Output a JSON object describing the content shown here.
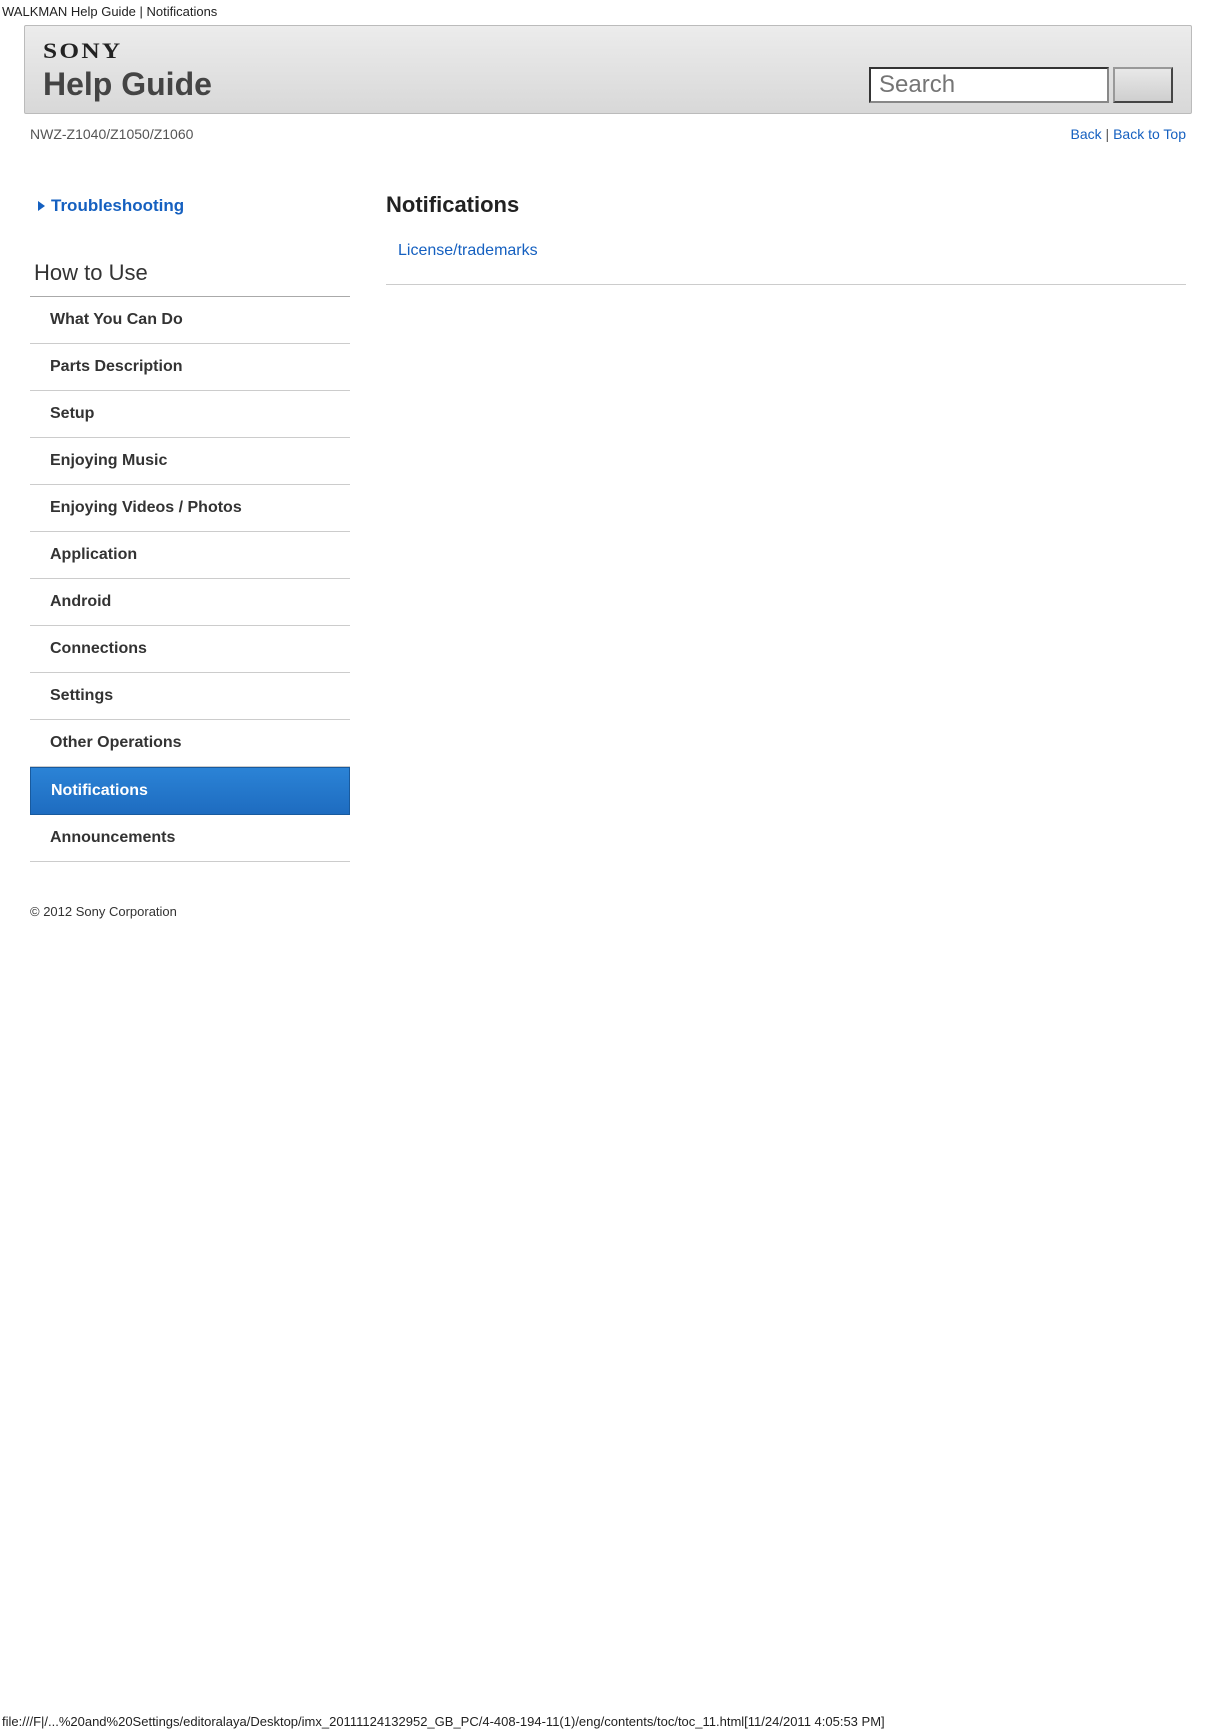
{
  "browser_title": "WALKMAN Help Guide | Notifications",
  "header": {
    "brand": "SONY",
    "title": "Help Guide"
  },
  "search": {
    "placeholder": "Search"
  },
  "subheader": {
    "model": "NWZ-Z1040/Z1050/Z1060",
    "back": "Back",
    "sep": " | ",
    "back_to_top": "Back to Top"
  },
  "sidebar": {
    "troubleshooting": "Troubleshooting",
    "how_to_use": "How to Use",
    "items": [
      {
        "label": "What You Can Do",
        "active": false
      },
      {
        "label": "Parts Description",
        "active": false
      },
      {
        "label": "Setup",
        "active": false
      },
      {
        "label": "Enjoying Music",
        "active": false
      },
      {
        "label": "Enjoying Videos / Photos",
        "active": false
      },
      {
        "label": "Application",
        "active": false
      },
      {
        "label": "Android",
        "active": false
      },
      {
        "label": "Connections",
        "active": false
      },
      {
        "label": "Settings",
        "active": false
      },
      {
        "label": "Other Operations",
        "active": false
      },
      {
        "label": "Notifications",
        "active": true
      },
      {
        "label": "Announcements",
        "active": false
      }
    ]
  },
  "main": {
    "title": "Notifications",
    "link": "License/trademarks"
  },
  "copyright": "© 2012 Sony Corporation",
  "footer_path": "file:///F|/...%20and%20Settings/editoralaya/Desktop/imx_20111124132952_GB_PC/4-408-194-11(1)/eng/contents/toc/toc_11.html[11/24/2011 4:05:53 PM]"
}
